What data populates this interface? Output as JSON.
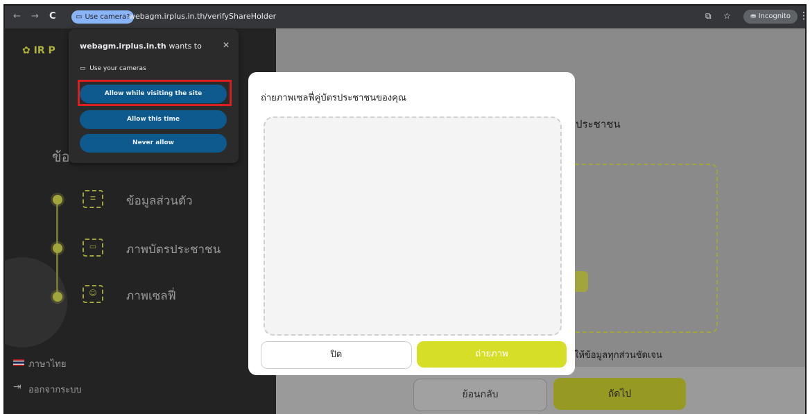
{
  "browser": {
    "back": "←",
    "forward": "→",
    "reload": "C",
    "camera_chip": "Use camera?",
    "url": "webagm.irplus.in.th/verifyShareHolder",
    "translate_icon": "⧉",
    "star_icon": "☆",
    "incognito": "Incognito",
    "menu": "⋮"
  },
  "sidebar": {
    "logo": "IR P",
    "title_fragment": "ข้อ",
    "steps": [
      {
        "icon": "≡",
        "label": "ข้อมูลส่วนตัว"
      },
      {
        "icon": "▭",
        "label": "ภาพบัตรประชาชน"
      },
      {
        "icon": "☺",
        "label": "ภาพเซลฟี่"
      }
    ],
    "language": "ภาษาไทย",
    "logout": "ออกจากระบบ",
    "logout_icon": "⇥"
  },
  "main": {
    "heading_fragment": "ประชาชน",
    "note_fragment": "ให้ข้อมูลทุกส่วนชัดเจน",
    "back_button": "ย้อนกลับ",
    "next_button": "ถัดไป"
  },
  "permission_popup": {
    "site": "webagm.irplus.in.th",
    "wants_to": "wants to",
    "close": "✕",
    "camera_icon": "▭",
    "camera_text": "Use your cameras",
    "allow_while": "Allow while visiting the site",
    "allow_once": "Allow this time",
    "never": "Never allow"
  },
  "modal": {
    "title": "ถ่ายภาพเซลฟี่คู่บัตรประชาชนของคุณ",
    "close_button": "ปิด",
    "capture_button": "ถ่ายภาพ"
  }
}
